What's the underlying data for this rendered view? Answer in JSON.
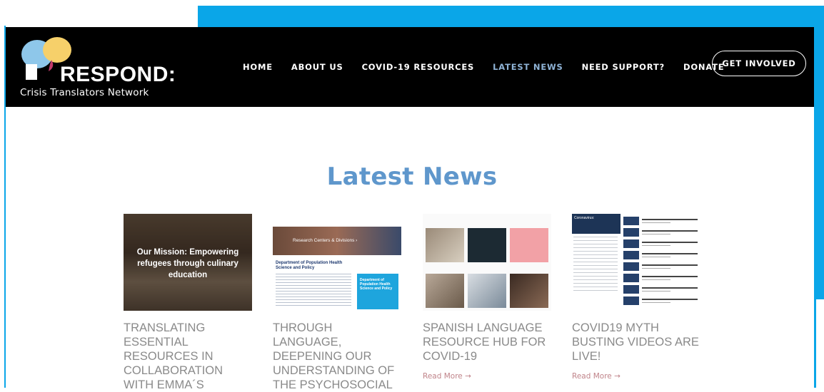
{
  "brand": {
    "name": "RESPOND:",
    "tagline": "Crisis Translators Network",
    "colors": {
      "accent": "#0aa6e8",
      "header_bg": "#000000",
      "title": "#5f97cc",
      "link": "#c0848a"
    }
  },
  "nav": {
    "items": [
      {
        "label": "HOME",
        "active": false
      },
      {
        "label": "ABOUT US",
        "active": false
      },
      {
        "label": "COVID-19 RESOURCES",
        "active": false
      },
      {
        "label": "LATEST NEWS",
        "active": true
      },
      {
        "label": "NEED SUPPORT?",
        "active": false
      },
      {
        "label": "DONATE",
        "active": false
      }
    ],
    "cta": "GET INVOLVED"
  },
  "main": {
    "title": "Latest News",
    "read_more": "Read More →",
    "cards": [
      {
        "title": "TRANSLATING ESSENTIAL RESOURCES IN COLLABORATION WITH EMMA´S",
        "thumb_caption": "Our Mission: Empowering refugees through culinary education"
      },
      {
        "title": "THROUGH LANGUAGE, DEEPENING OUR UNDERSTANDING OF THE PSYCHOSOCIAL",
        "thumb_heading": "Department of Population Health Science and Policy",
        "thumb_banner": "Research Centers & Divisions ›",
        "thumb_box": "Department of Population Health Science and Policy"
      },
      {
        "title": "SPANISH LANGUAGE RESOURCE HUB FOR COVID-19"
      },
      {
        "title": "COVID19 MYTH BUSTING VIDEOS ARE LIVE!",
        "thumb_video": "Coronavirus:"
      }
    ]
  }
}
